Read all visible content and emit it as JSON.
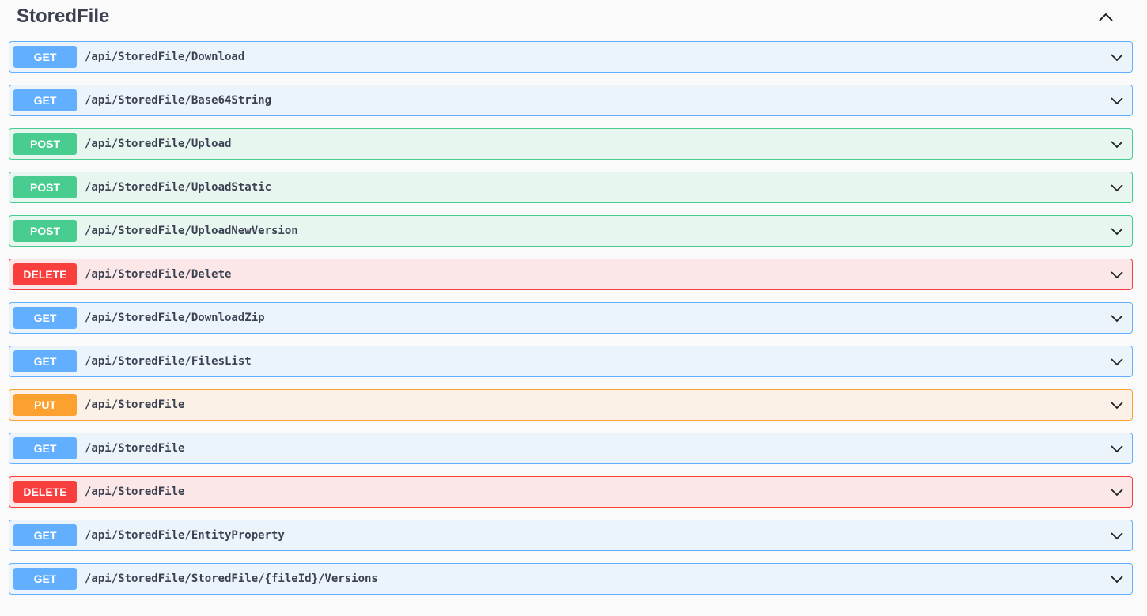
{
  "section": {
    "title": "StoredFile",
    "expanded_icon": "chevron-up-icon",
    "row_icon": "chevron-down-icon"
  },
  "method_colors": {
    "GET": "#61affe",
    "POST": "#49cc90",
    "DELETE": "#f93e3e",
    "PUT": "#fca130"
  },
  "operations": [
    {
      "method": "GET",
      "path": "/api/StoredFile/Download"
    },
    {
      "method": "GET",
      "path": "/api/StoredFile/Base64String"
    },
    {
      "method": "POST",
      "path": "/api/StoredFile/Upload"
    },
    {
      "method": "POST",
      "path": "/api/StoredFile/UploadStatic"
    },
    {
      "method": "POST",
      "path": "/api/StoredFile/UploadNewVersion"
    },
    {
      "method": "DELETE",
      "path": "/api/StoredFile/Delete"
    },
    {
      "method": "GET",
      "path": "/api/StoredFile/DownloadZip"
    },
    {
      "method": "GET",
      "path": "/api/StoredFile/FilesList"
    },
    {
      "method": "PUT",
      "path": "/api/StoredFile"
    },
    {
      "method": "GET",
      "path": "/api/StoredFile"
    },
    {
      "method": "DELETE",
      "path": "/api/StoredFile"
    },
    {
      "method": "GET",
      "path": "/api/StoredFile/EntityProperty"
    },
    {
      "method": "GET",
      "path": "/api/StoredFile/StoredFile/{fileId}/Versions"
    }
  ]
}
